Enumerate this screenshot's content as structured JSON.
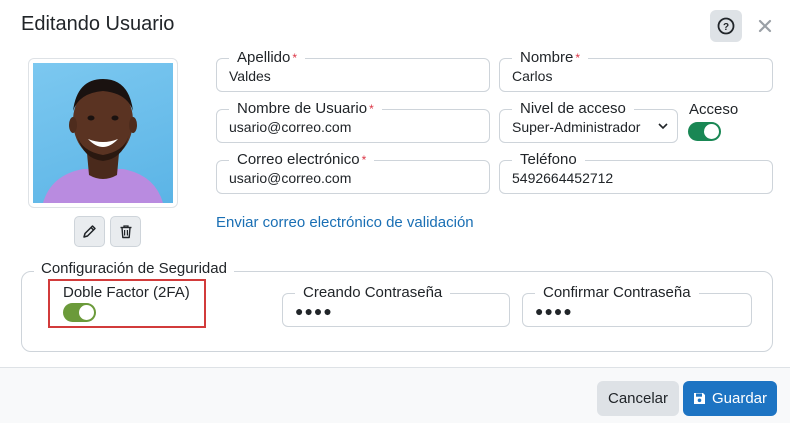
{
  "modal": {
    "title": "Editando Usuario"
  },
  "user": {
    "avatar_description": "profile-photo"
  },
  "fields": {
    "apellido": {
      "label": "Apellido",
      "required": "*",
      "value": "Valdes"
    },
    "nombre": {
      "label": "Nombre",
      "required": "*",
      "value": "Carlos"
    },
    "nombre_usuario": {
      "label": "Nombre de Usuario",
      "required": "*",
      "value": "usario@correo.com"
    },
    "nivel_acceso": {
      "label": "Nivel de acceso",
      "value": "Super-Administrador"
    },
    "acceso": {
      "label": "Acceso",
      "enabled": true
    },
    "correo": {
      "label": "Correo electrónico",
      "required": "*",
      "value": "usario@correo.com"
    },
    "telefono": {
      "label": "Teléfono",
      "value": "5492664452712"
    }
  },
  "links": {
    "send_validation": "Enviar correo electrónico de validación"
  },
  "security": {
    "legend": "Configuración de Seguridad",
    "twofa_label": "Doble Factor (2FA)",
    "twofa_enabled": true,
    "new_password": {
      "label": "Creando Contraseña",
      "value": "●●●●"
    },
    "confirm_password": {
      "label": "Confirmar Contraseña",
      "value": "●●●●"
    }
  },
  "footer": {
    "cancel_label": "Cancelar",
    "save_label": "Guardar"
  },
  "colors": {
    "primary": "#1d74c3",
    "toggle_on_green": "#198754",
    "toggle_on_olive": "#6b9a3a",
    "required": "#dc3545",
    "link": "#1a6fb4",
    "highlight": "#d23b3b"
  },
  "icons": {
    "help": "help-circle-icon",
    "close": "close-icon",
    "edit": "pencil-icon",
    "delete": "trash-icon",
    "save": "floppy-disk-icon",
    "select": "chevron-down-icon"
  }
}
